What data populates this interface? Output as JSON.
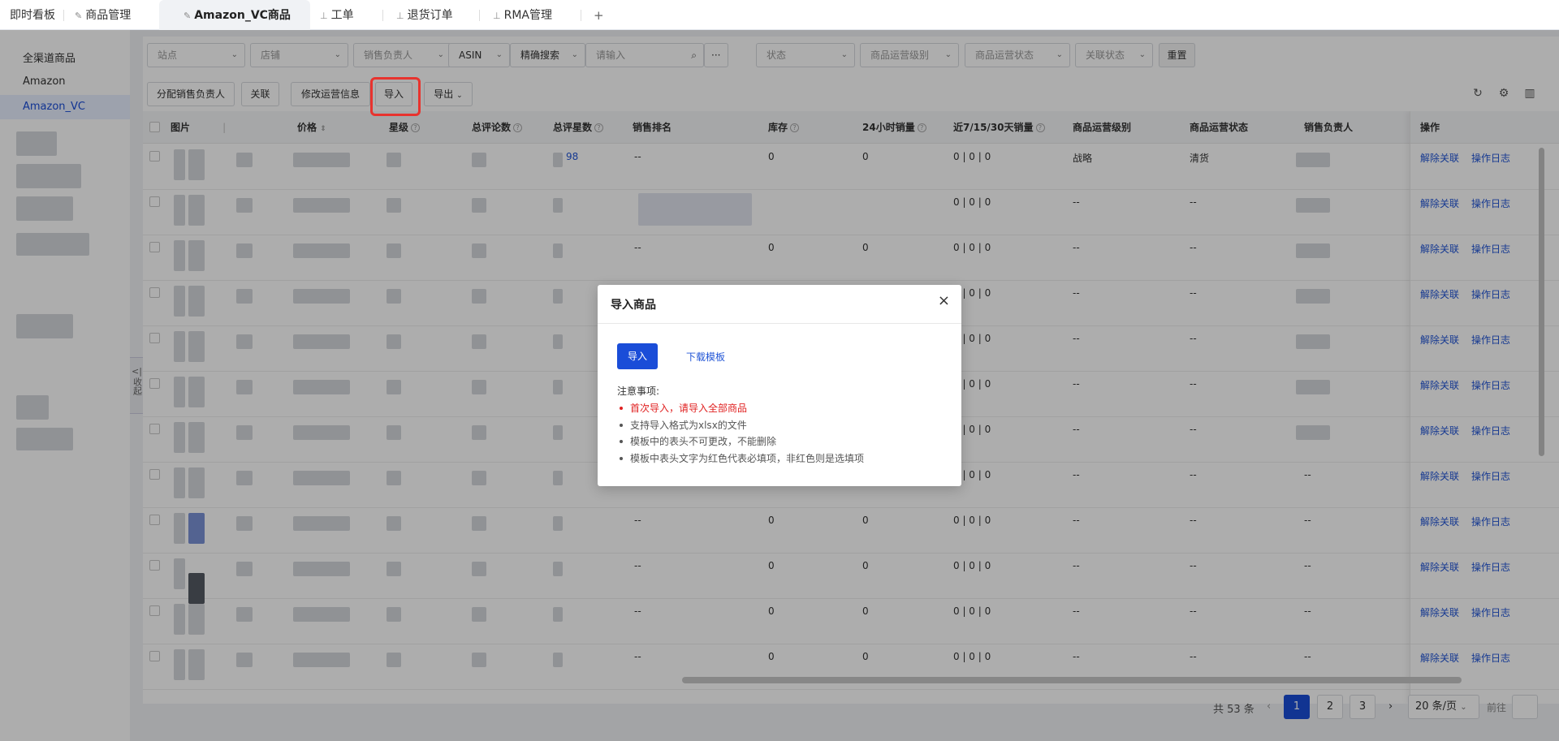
{
  "tabs": [
    {
      "label": "即时看板",
      "pinned": false
    },
    {
      "label": "商品管理",
      "pinned": true
    },
    {
      "label": "Amazon_VC商品",
      "pinned": true,
      "active": true
    },
    {
      "label": "工单",
      "pinned": true
    },
    {
      "label": "退货订单",
      "pinned": true
    },
    {
      "label": "RMA管理",
      "pinned": true
    }
  ],
  "tab_add": "+",
  "sidebar": {
    "items": [
      "全渠道商品",
      "Amazon",
      "Amazon_VC"
    ],
    "collapse_label": "收起"
  },
  "filters": {
    "site": "站点",
    "shop": "店铺",
    "sales_owner": "销售负责人",
    "asin": "ASIN",
    "search_mode": "精确搜索",
    "search_placeholder": "请输入",
    "more": "···",
    "status": "状态",
    "op_level": "商品运营级别",
    "op_status": "商品运营状态",
    "link_status": "关联状态",
    "reset": "重置"
  },
  "toolbar": {
    "assign": "分配销售负责人",
    "link": "关联",
    "edit_info": "修改运营信息",
    "import": "导入",
    "export": "导出"
  },
  "table": {
    "headers": [
      "图片",
      "价格",
      "星级",
      "总评论数",
      "总评星数",
      "销售排名",
      "库存",
      "24小时销量",
      "近7/15/30天销量",
      "商品运营级别",
      "商品运营状态",
      "销售负责人",
      "操作"
    ],
    "rows": [
      {
        "rating_total": "98",
        "rank": "--",
        "stock": "0",
        "h24": "0",
        "sales": "0 | 0 | 0",
        "level": "战略",
        "status": "清货",
        "owner": "",
        "dash_owner": false
      },
      {
        "rating_total": "",
        "rank": "",
        "stock": "",
        "h24": "",
        "sales": "0 | 0 | 0",
        "level": "--",
        "status": "--",
        "owner": "",
        "dash_owner": false
      },
      {
        "rating_total": "",
        "rank": "--",
        "stock": "0",
        "h24": "0",
        "sales": "0 | 0 | 0",
        "level": "--",
        "status": "--",
        "owner": "",
        "dash_owner": false
      },
      {
        "rating_total": "",
        "rank": "",
        "stock": "",
        "h24": "",
        "sales": "0 | 0 | 0",
        "level": "--",
        "status": "--",
        "owner": "",
        "dash_owner": false
      },
      {
        "rating_total": "",
        "rank": "",
        "stock": "",
        "h24": "",
        "sales": "0 | 0 | 0",
        "level": "--",
        "status": "--",
        "owner": "",
        "dash_owner": false
      },
      {
        "rating_total": "",
        "rank": "",
        "stock": "",
        "h24": "",
        "sales": "0 | 0 | 0",
        "level": "--",
        "status": "--",
        "owner": "",
        "dash_owner": false
      },
      {
        "rating_total": "",
        "rank": "",
        "stock": "",
        "h24": "",
        "sales": "0 | 0 | 0",
        "level": "--",
        "status": "--",
        "owner": "",
        "dash_owner": false
      },
      {
        "rating_total": "",
        "rank": "",
        "stock": "",
        "h24": "",
        "sales": "0 | 0 | 0",
        "level": "--",
        "status": "--",
        "owner": "--",
        "dash_owner": true
      },
      {
        "rating_total": "",
        "rank": "--",
        "stock": "0",
        "h24": "0",
        "sales": "0 | 0 | 0",
        "level": "--",
        "status": "--",
        "owner": "--",
        "dash_owner": true
      },
      {
        "rating_total": "",
        "rank": "--",
        "stock": "0",
        "h24": "0",
        "sales": "0 | 0 | 0",
        "level": "--",
        "status": "--",
        "owner": "--",
        "dash_owner": true
      },
      {
        "rating_total": "",
        "rank": "--",
        "stock": "0",
        "h24": "0",
        "sales": "0 | 0 | 0",
        "level": "--",
        "status": "--",
        "owner": "--",
        "dash_owner": true
      },
      {
        "rating_total": "",
        "rank": "--",
        "stock": "0",
        "h24": "0",
        "sales": "0 | 0 | 0",
        "level": "--",
        "status": "--",
        "owner": "--",
        "dash_owner": true
      }
    ],
    "action_unlink": "解除关联",
    "action_log": "操作日志"
  },
  "pagination": {
    "total": "共 53 条",
    "pages": [
      "1",
      "2",
      "3"
    ],
    "current": "1",
    "prev": "‹",
    "next": "›",
    "page_size": "20 条/页",
    "goto": "前往"
  },
  "modal": {
    "title": "导入商品",
    "close": "×",
    "import": "导入",
    "download": "下载模板",
    "notes_title": "注意事项:",
    "notes": [
      {
        "text": "首次导入，请导入全部商品",
        "highlight": true
      },
      {
        "text": "支持导入格式为xlsx的文件",
        "highlight": false
      },
      {
        "text": "模板中的表头不可更改，不能删除",
        "highlight": false
      },
      {
        "text": "模板中表头文字为红色代表必填项，非红色则是选填项",
        "highlight": false
      }
    ]
  },
  "colors": {
    "accent": "#1a4dd8",
    "link": "#2155d6",
    "required": "#e02020",
    "highlight_border": "#e8332e"
  }
}
